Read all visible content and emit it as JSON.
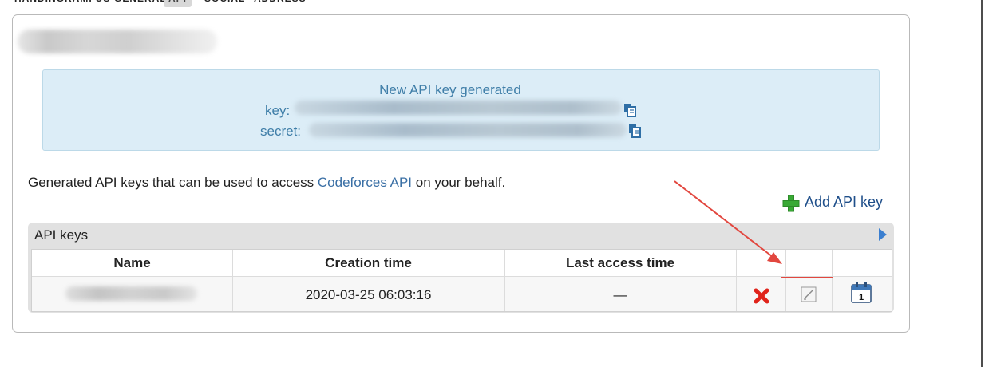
{
  "tabs": [
    {
      "label": "HANDINGRAMFUS",
      "active": false
    },
    {
      "label": "GENERAL",
      "active": false
    },
    {
      "label": "API",
      "active": true
    },
    {
      "label": "SOCIAL",
      "active": false
    },
    {
      "label": "ADDRESS",
      "active": false
    }
  ],
  "notice": {
    "headline": "New API key generated",
    "key_label": "key:",
    "secret_label": "secret:",
    "copy_icon": "copy-icon"
  },
  "description": {
    "before": "Generated API keys that can be used to access ",
    "link": "Codeforces API",
    "after": " on your behalf."
  },
  "add_key": {
    "label": "Add API key",
    "icon": "plus-icon"
  },
  "keys_table": {
    "caption": "API keys",
    "columns": [
      "Name",
      "Creation time",
      "Last access time"
    ],
    "rows": [
      {
        "name": "",
        "creation_time": "2020-03-25 06:03:16",
        "last_access": "—"
      }
    ],
    "row_actions": [
      "delete-icon",
      "edit-icon",
      "calendar-icon"
    ]
  },
  "colors": {
    "notice_bg": "#dcedf7",
    "notice_text": "#3f7ea8",
    "link": "#3a6fa5",
    "delete_red": "#e0241b",
    "plus_green": "#39a935",
    "annotation_red": "#e2473f"
  }
}
